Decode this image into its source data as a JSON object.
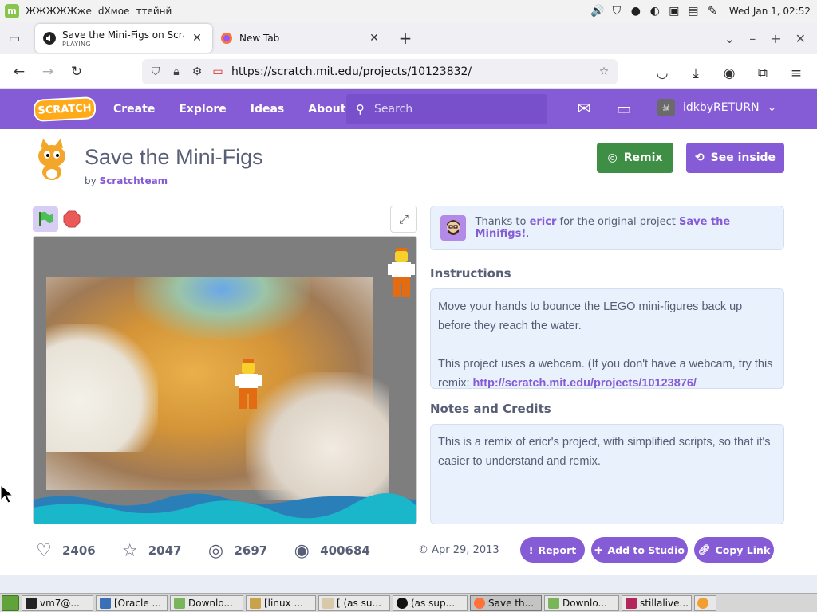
{
  "system_panel": {
    "menu_items": [
      "ЖЖЖЖЖже",
      "dХмое",
      "ттейнй"
    ],
    "clock": "Wed Jan 1, 02:52"
  },
  "browser": {
    "tabs": [
      {
        "title": "Save the Mini-Figs on Scratch",
        "subtitle": "PLAYING",
        "active": true
      },
      {
        "title": "New Tab",
        "subtitle": "",
        "active": false
      }
    ],
    "url": "https://scratch.mit.edu/projects/10123832/"
  },
  "scratch_header": {
    "logo": "SCRATCH",
    "nav": [
      "Create",
      "Explore",
      "Ideas",
      "About"
    ],
    "search_placeholder": "Search",
    "username": "idkbyRETURN"
  },
  "project": {
    "title": "Save the Mini-Figs",
    "by_prefix": "by",
    "author": "Scratchteam",
    "remix_label": "Remix",
    "see_inside_label": "See inside",
    "thanks": {
      "prefix": "Thanks to",
      "user": "ericr",
      "middle": "for the original project",
      "project": "Save the Minifigs!",
      "suffix": "."
    },
    "instructions_title": "Instructions",
    "instructions_p1": "Move your hands to bounce the LEGO mini-figures back up before they reach the water.",
    "instructions_p2_prefix": "This project uses a webcam. (If you don't have a webcam, try this remix:",
    "instructions_link": "http://scratch.mit.edu/projects/10123876/",
    "notes_title": "Notes and Credits",
    "notes_text": "This is a remix of ericr's project, with simplified scripts, so that it's easier to understand and remix.",
    "stats": {
      "loves": "2406",
      "favorites": "2047",
      "remixes": "2697",
      "views": "400684"
    },
    "date": "Apr 29, 2013",
    "report_label": "Report",
    "add_to_studio_label": "Add to Studio",
    "copy_link_label": "Copy Link"
  },
  "taskbar": [
    {
      "label": "vm7@...",
      "active": false
    },
    {
      "label": "[Oracle ...",
      "active": false
    },
    {
      "label": "Downlo...",
      "active": false
    },
    {
      "label": "[linux ...",
      "active": false
    },
    {
      "label": "[ (as su...",
      "active": false
    },
    {
      "label": "(as sup...",
      "active": false
    },
    {
      "label": "Save th...",
      "active": true
    },
    {
      "label": "Downlo...",
      "active": false
    },
    {
      "label": "stillalive...",
      "active": false
    }
  ],
  "colors": {
    "scratch_purple": "#855cd6",
    "remix_green": "#3e8e46",
    "text_gray": "#575e75",
    "panel_blue": "#e9f1fc"
  }
}
